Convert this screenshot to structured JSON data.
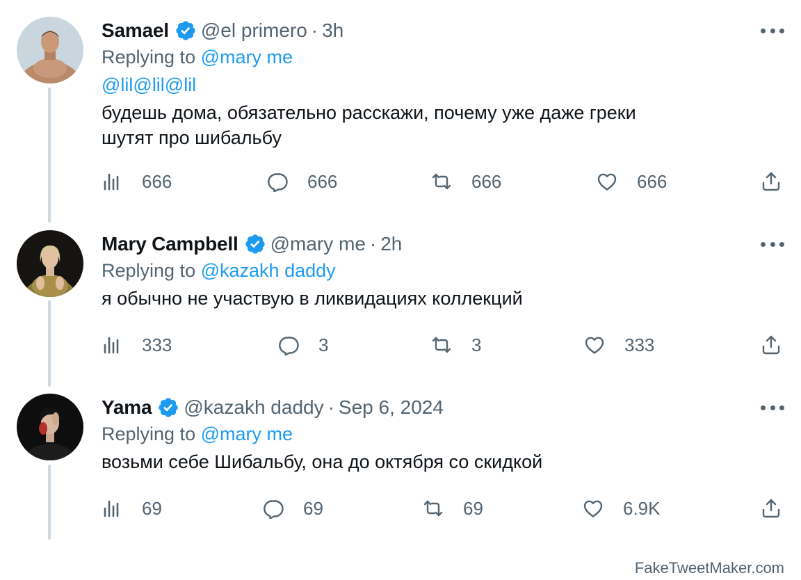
{
  "tweets": [
    {
      "name": "Samael",
      "handle": "@el primero",
      "separator": "·",
      "time": "3h",
      "reply_prefix": "Replying to",
      "reply_to": "@mary me",
      "mention": "@lil@lil@lil",
      "text_lines": [
        " будешь дома, обязательно расскажи, почему уже даже греки",
        "шутят про шибальбу"
      ],
      "stats": {
        "views": "666",
        "replies": "666",
        "retweets": "666",
        "likes": "666"
      }
    },
    {
      "name": "Mary Campbell",
      "handle": "@mary me",
      "separator": "·",
      "time": "2h",
      "reply_prefix": "Replying to",
      "reply_to": "@kazakh daddy",
      "text_lines": [
        "я обычно не участвую в ликвидациях коллекций"
      ],
      "stats": {
        "views": "333",
        "replies": "3",
        "retweets": "3",
        "likes": "333"
      }
    },
    {
      "name": "Yama",
      "handle": "@kazakh daddy",
      "separator": "·",
      "time": "Sep 6, 2024",
      "reply_prefix": "Replying to",
      "reply_to": "@mary me",
      "text_lines": [
        "возьми себе Шибальбу, она до октября со скидкой"
      ],
      "stats": {
        "views": "69",
        "replies": "69",
        "retweets": "69",
        "likes": "6.9K"
      }
    }
  ],
  "watermark": "FakeTweetMaker.com",
  "colors": {
    "accent": "#1d9bf0",
    "secondary": "#536471",
    "text": "#0f1419",
    "thread_line": "#cfd9de"
  },
  "icons": [
    "verified-badge-icon",
    "more-icon",
    "views-icon",
    "reply-icon",
    "retweet-icon",
    "like-icon",
    "share-icon"
  ]
}
